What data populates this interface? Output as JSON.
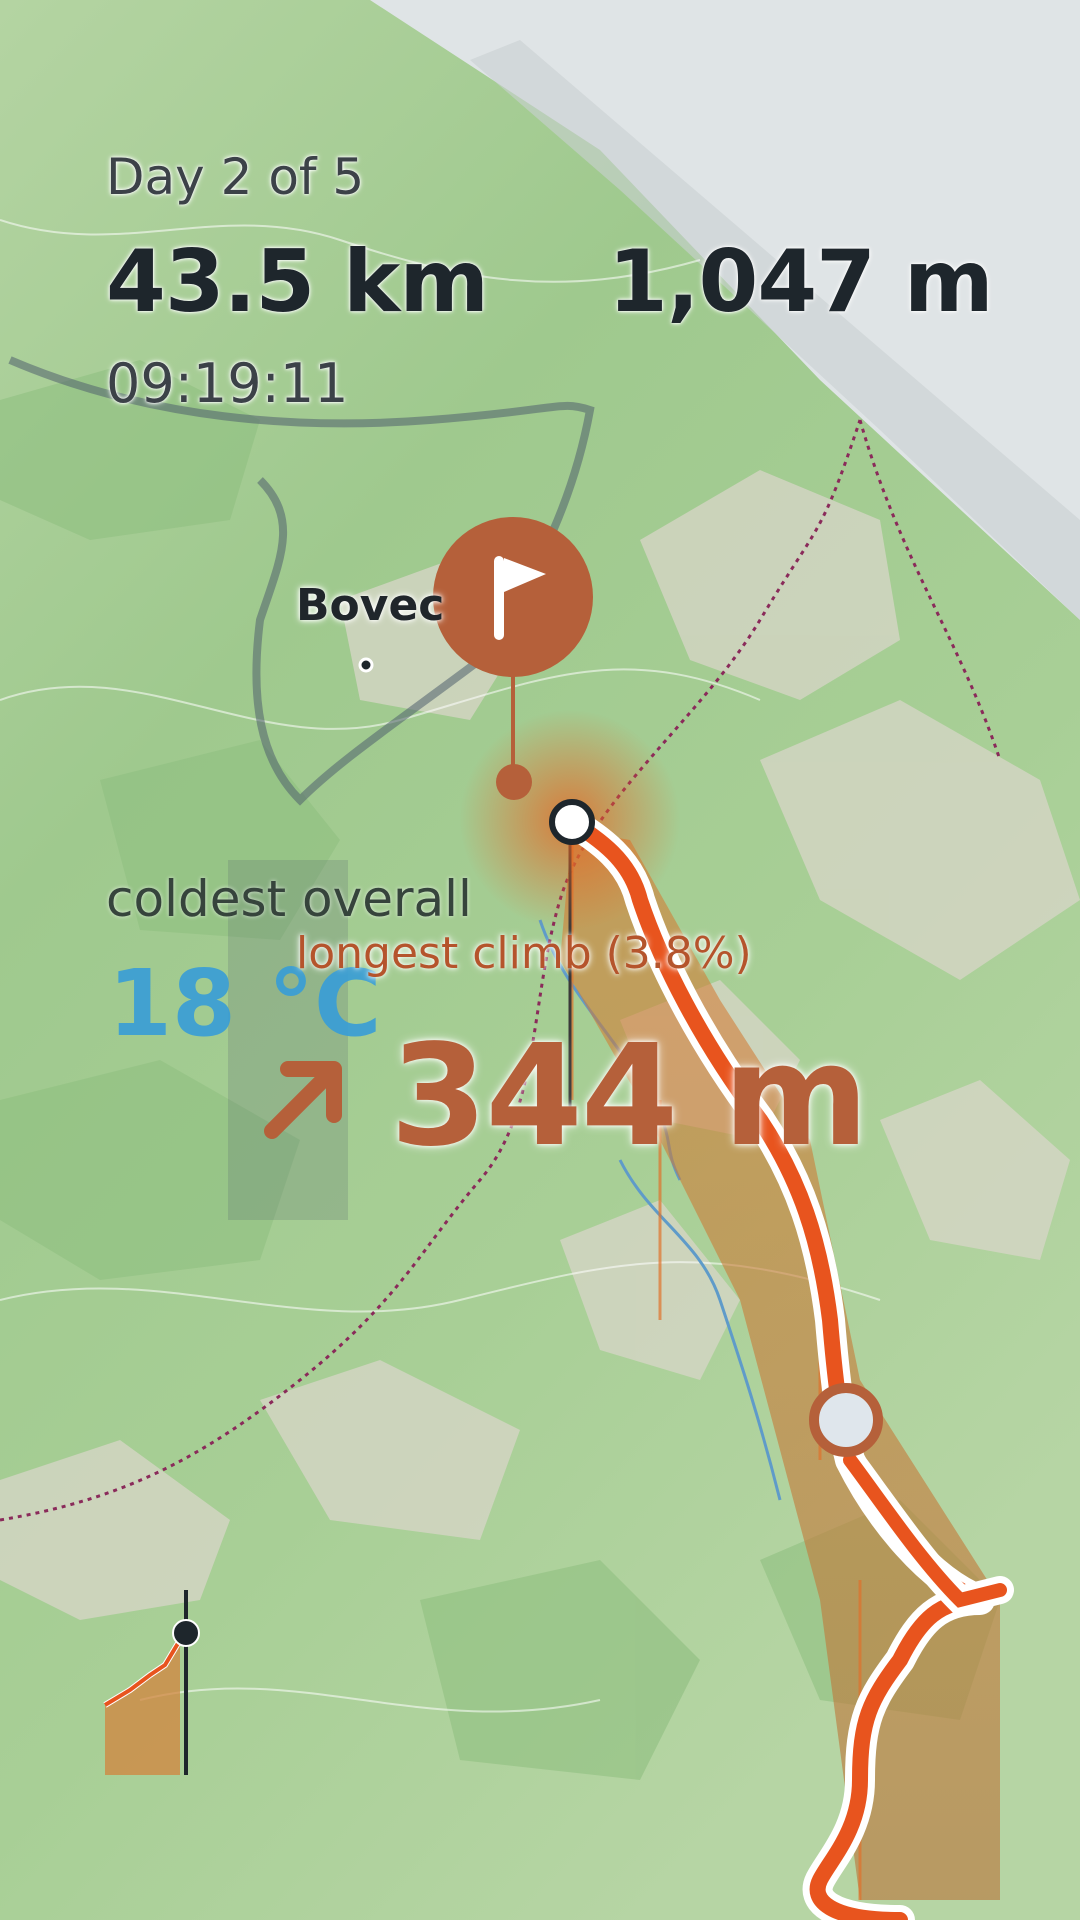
{
  "stats": {
    "day_label": "Day 2 of 5",
    "distance": "43.5 km",
    "elevation_gain": "1,047 m",
    "duration": "09:19:11"
  },
  "map": {
    "town_label": "Bovec"
  },
  "highlights": {
    "coldest_label": "coldest overall",
    "coldest_value": "18 °C",
    "climb_label": "longest climb (3.8%)",
    "climb_value": "344 m"
  },
  "colors": {
    "route": "#e8541e",
    "marker": "#b5603a",
    "cold": "#3a9ed6",
    "text": "#1e262c"
  },
  "icons": {
    "flag": "flag-icon",
    "climb": "arrow-up-right-icon"
  }
}
